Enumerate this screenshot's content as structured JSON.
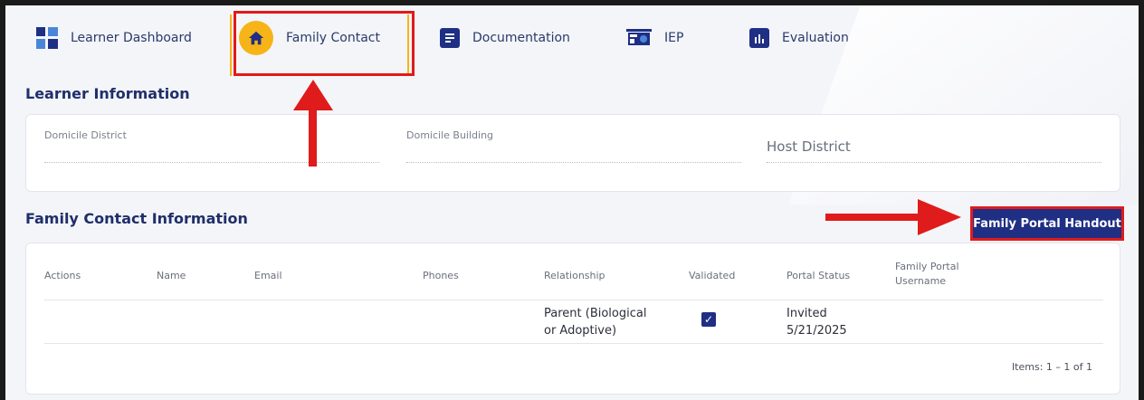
{
  "nav": {
    "items": [
      {
        "label": "Learner Dashboard",
        "icon": "dashboard-icon"
      },
      {
        "label": "Family Contact",
        "icon": "home-icon",
        "active": true
      },
      {
        "label": "Documentation",
        "icon": "document-icon"
      },
      {
        "label": "IEP",
        "icon": "iep-icon"
      },
      {
        "label": "Evaluation",
        "icon": "chart-icon"
      }
    ]
  },
  "learner_info": {
    "title": "Learner Information",
    "fields": {
      "domicile_district": "Domicile District",
      "domicile_building": "Domicile Building",
      "host_district": "Host District"
    }
  },
  "family_contact": {
    "title": "Family Contact Information",
    "handout_button": "Family Portal Handout",
    "columns": [
      "Actions",
      "Name",
      "Email",
      "Phones",
      "Relationship",
      "Validated",
      "Portal Status",
      "Family Portal Username"
    ],
    "rows": [
      {
        "actions": "",
        "name": "",
        "email": "",
        "phones": "",
        "relationship": "Parent (Biological or Adoptive)",
        "validated": true,
        "portal_status": "Invited 5/21/2025",
        "username": ""
      }
    ],
    "pager": "Items: 1 – 1 of 1"
  },
  "colors": {
    "brand": "#1f2f84",
    "accent": "#f6b418",
    "highlight": "#e01b1b"
  }
}
